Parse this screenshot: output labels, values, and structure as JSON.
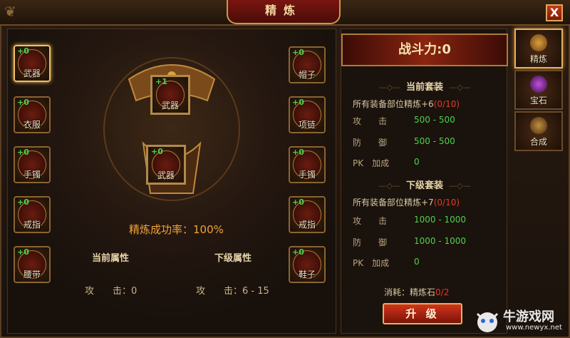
{
  "window": {
    "title": "精炼",
    "close_label": "X"
  },
  "left_slots": [
    {
      "label": "武器",
      "plus": "+0"
    },
    {
      "label": "衣服",
      "plus": "+0"
    },
    {
      "label": "手镯",
      "plus": "+0"
    },
    {
      "label": "戒指",
      "plus": "+0"
    },
    {
      "label": "腰带",
      "plus": "+0"
    }
  ],
  "right_slots": [
    {
      "label": "帽子",
      "plus": "+0"
    },
    {
      "label": "项链",
      "plus": "+0"
    },
    {
      "label": "手镯",
      "plus": "+0"
    },
    {
      "label": "戒指",
      "plus": "+0"
    },
    {
      "label": "鞋子",
      "plus": "+0"
    }
  ],
  "center": {
    "top_slot": {
      "label": "武器",
      "plus": "+1"
    },
    "bottom_slot": {
      "label": "武器",
      "plus": "+0"
    },
    "success_rate": "精炼成功率：100%"
  },
  "attributes": {
    "current_header": "当前属性",
    "next_header": "下级属性",
    "current_label": "攻　　击：0",
    "next_label": "攻　　击：6 - 15"
  },
  "power": {
    "label": "战斗力:0"
  },
  "current_set": {
    "title": "当前套装",
    "desc": "所有装备部位精炼+6",
    "count": "(0/10)",
    "stats": [
      {
        "name": "攻　　击",
        "value": "500 - 500"
      },
      {
        "name": "防　　御",
        "value": "500 - 500"
      },
      {
        "name": "PK　加成",
        "value": "0"
      }
    ]
  },
  "next_set": {
    "title": "下级套装",
    "desc": "所有装备部位精炼+7",
    "count": "(0/10)",
    "stats": [
      {
        "name": "攻　　击",
        "value": "1000 - 1000"
      },
      {
        "name": "防　　御",
        "value": "1000 - 1000"
      },
      {
        "name": "PK　加成",
        "value": "0"
      }
    ]
  },
  "consume": {
    "label": "消耗：精炼石",
    "count": "0/2"
  },
  "upgrade_button": "升 级",
  "side_tabs": [
    {
      "label": "精炼",
      "active": true
    },
    {
      "label": "宝石",
      "active": false
    },
    {
      "label": "合成",
      "active": false
    }
  ],
  "watermark": {
    "name": "牛游戏网",
    "url": "www.newyx.net"
  }
}
